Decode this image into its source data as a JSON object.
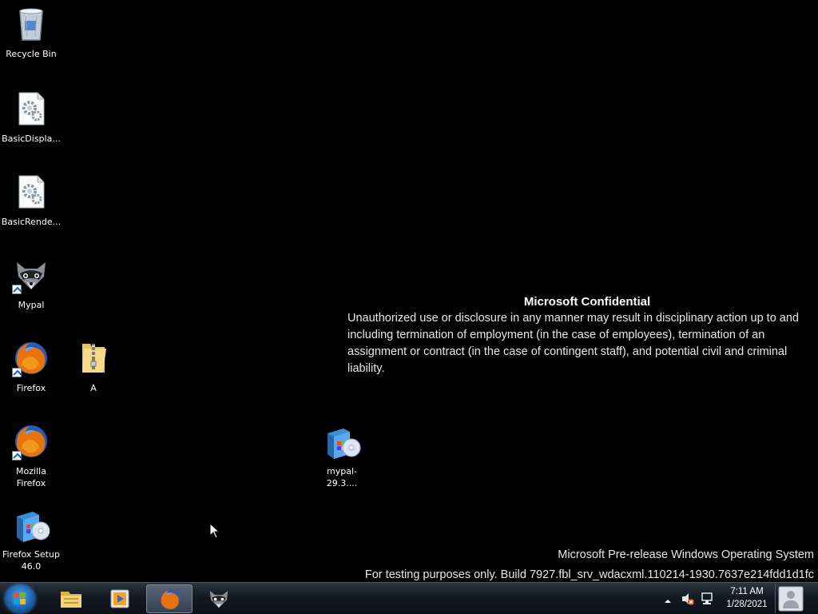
{
  "desktop": {
    "icons": [
      {
        "label": "Recycle Bin",
        "icon": "recycle-bin-icon"
      },
      {
        "label": "BasicDispla...",
        "icon": "settings-file-icon"
      },
      {
        "label": "BasicRende...",
        "icon": "settings-file-icon"
      },
      {
        "label": "Mypal",
        "icon": "mypal-raccoon-icon"
      },
      {
        "label": "Firefox",
        "icon": "firefox-icon"
      },
      {
        "label": "A",
        "icon": "zip-folder-icon"
      },
      {
        "label": "Mozilla Firefox",
        "icon": "firefox-icon"
      },
      {
        "label": "Firefox Setup 46.0",
        "icon": "installer-icon"
      },
      {
        "label": "mypal-29.3....",
        "icon": "installer-icon"
      }
    ]
  },
  "watermark": {
    "title": "Microsoft Confidential",
    "body": "Unauthorized use or disclosure in any manner may result in disciplinary action up to and including termination of employment (in the case of employees), termination of an assignment or contract (in the case of contingent staff), and potential civil and criminal liability.",
    "os_line": "Microsoft Pre-release Windows Operating System",
    "build_line": "For testing purposes only. Build 7927.fbl_srv_wdacxml.110214-1930.7637e214fdd1d1fc"
  },
  "taskbar": {
    "start_icon": "windows-logo-icon",
    "pinned": [
      {
        "icon": "windows-explorer-icon"
      },
      {
        "icon": "media-player-icon"
      },
      {
        "icon": "firefox-icon",
        "active": true
      },
      {
        "icon": "mypal-raccoon-icon"
      }
    ],
    "clock": {
      "time": "7:11 AM",
      "date": "1/28/2021"
    },
    "tray_icons": [
      "show-hidden-icons-arrow",
      "speaker-muted-icon",
      "network-icon"
    ]
  },
  "colors": {
    "desktop_bg": "#000000",
    "taskbar_top": "#2b3540",
    "taskbar_bottom": "#0b1117"
  }
}
